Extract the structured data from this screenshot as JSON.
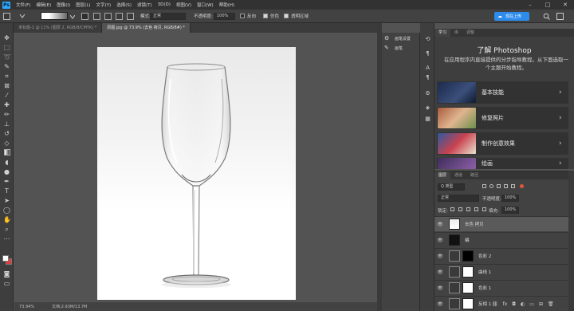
{
  "app": {
    "logo": "Ps"
  },
  "menu": [
    "文件(F)",
    "编辑(E)",
    "图像(I)",
    "图层(L)",
    "文字(Y)",
    "选择(S)",
    "滤镜(T)",
    "3D(D)",
    "视图(V)",
    "窗口(W)",
    "帮助(H)"
  ],
  "window_controls": [
    "–",
    "□",
    "✕"
  ],
  "cloud_button": "现在上传",
  "options": {
    "mode_label": "模式:",
    "mode_value": "正常",
    "opacity_label": "不透明度:",
    "opacity_value": "100%",
    "reverse_label": "反向",
    "dither_label": "仿色",
    "transparency_label": "透明区域"
  },
  "tabs": [
    "未标题-1 @ 11% (图层 2, RGB/8/CMYK) *",
    "原图.jpg @ 73.9% (去色 拷贝, RGB/8#) *"
  ],
  "status": {
    "zoom": "73.94%",
    "doc": "文档:2.93M/13.7M"
  },
  "mini_panel": [
    {
      "icon": "adjust-icon",
      "label": "画笔设置"
    },
    {
      "icon": "brush-icon",
      "label": "画笔"
    }
  ],
  "learn": {
    "tabs": [
      "学习",
      "库",
      "调整"
    ],
    "title": "了解 Photoshop",
    "desc": "在应用程序内直接提供的分步指导教程。从下面选取一个主题开始教程。",
    "cards": [
      {
        "label": "基本技能",
        "color": "#1f2a44"
      },
      {
        "label": "修复照片",
        "color": "#b56d4a"
      },
      {
        "label": "制作创意效果",
        "color": "#c8424f"
      },
      {
        "label": "绘画",
        "color": "#3f2e5c"
      }
    ]
  },
  "layers": {
    "tabs": [
      "图层",
      "通道",
      "路径"
    ],
    "kind_label": "Q 类型",
    "blend": "正常",
    "opacity_label": "不透明度:",
    "opacity_value": "100%",
    "lock_label": "锁定:",
    "fill_label": "填充:",
    "fill_value": "100%",
    "rows": [
      {
        "name": "去色 拷贝",
        "selected": true
      },
      {
        "name": "编"
      },
      {
        "name": "色彩 2"
      },
      {
        "name": "曲线 1"
      },
      {
        "name": "色彩 1"
      },
      {
        "name": "反相 1"
      }
    ]
  }
}
